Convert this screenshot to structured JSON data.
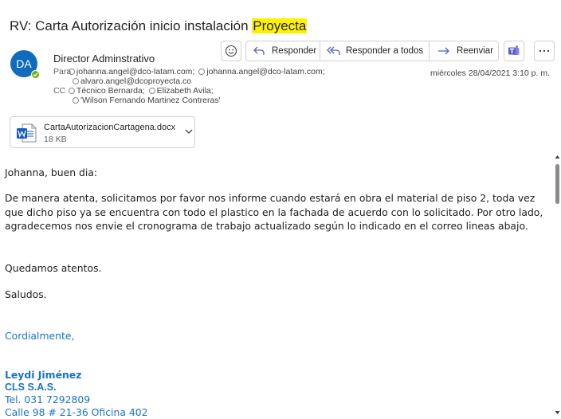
{
  "email": {
    "subject_prefix": "RV: Carta Autorización inicio instalación ",
    "subject_highlight": "Proyecta",
    "avatar_initials": "DA",
    "sender": "Director Adminstrativo",
    "to_label": "Para",
    "to_line1_a": "johanna.angel@dco-latam.com;",
    "to_line1_b": "johanna.angel@dco-latam.com;",
    "to_line2": "alvaro.angel@dcoproyecta.co",
    "cc_label": "CC",
    "cc_line1_a": "Técnico Bernarda;",
    "cc_line1_b": "Elizabeth Avila;",
    "cc_line2": "'Wilson Fernando Martinez Contreras'",
    "date": "miércoles 28/04/2021 3:10 p. m."
  },
  "toolbar": {
    "emoji_icon": "emoji-icon",
    "reply_label": "Responder",
    "reply_all_label": "Responder a todos",
    "forward_label": "Reenviar",
    "teams_icon": "teams-icon",
    "more_icon": "more-icon"
  },
  "attachment": {
    "name": "CartaAutorizacionCartagena.docx",
    "size": "18 KB",
    "icon": "word-icon"
  },
  "body": {
    "greeting": "Johanna, buen dia:",
    "paragraph": "De manera atenta, solicitamos por favor nos informe cuando estará en obra el material de piso 2, toda vez que dicho piso ya se encuentra con todo el plastico en la fachada de acuerdo con lo solicitado. Por otro lado, agradecemos nos envie el cronograma de trabajo actualizado según lo indicado en el correo lineas abajo.",
    "closing1": "Quedamos atentos.",
    "closing2": "Saludos.",
    "cordial": "Cordialmente,",
    "sig_name": "Leydi Jiménez",
    "sig_company": "CLS S.A.S.",
    "sig_phone": "Tel. 031 7292809",
    "sig_address": "Calle 98 # 21-36 Oficina 402"
  },
  "colors": {
    "accent": "#0f6cbd",
    "highlight": "#fff100",
    "link_blue": "#1a73c8",
    "presence": "#6bb700",
    "teams": "#5b5fc7"
  }
}
